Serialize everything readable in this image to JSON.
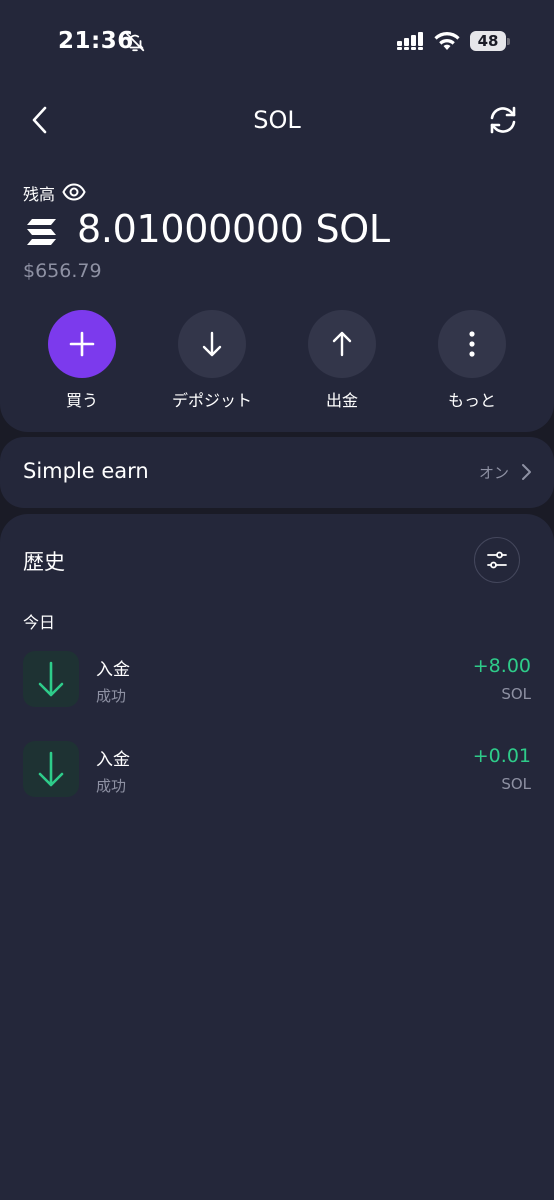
{
  "status_bar": {
    "time": "21:36",
    "battery": "48"
  },
  "header": {
    "title": "SOL"
  },
  "balance": {
    "label": "残高",
    "amount": "8.01000000 SOL",
    "fiat": "$656.79"
  },
  "actions": [
    {
      "label": "買う",
      "icon": "plus-icon"
    },
    {
      "label": "デポジット",
      "icon": "arrow-down-icon"
    },
    {
      "label": "出金",
      "icon": "arrow-up-icon"
    },
    {
      "label": "もっと",
      "icon": "more-vertical-icon"
    }
  ],
  "earn": {
    "title": "Simple earn",
    "status": "オン"
  },
  "history": {
    "title": "歴史",
    "day_label": "今日",
    "transactions": [
      {
        "title": "入金",
        "status": "成功",
        "amount": "+8.00",
        "unit": "SOL"
      },
      {
        "title": "入金",
        "status": "成功",
        "amount": "+0.01",
        "unit": "SOL"
      }
    ]
  },
  "colors": {
    "background": "#1a1b26",
    "card": "#24273a",
    "accent": "#7c3aed",
    "positive": "#2ecc8a",
    "muted": "#8e91a3"
  }
}
